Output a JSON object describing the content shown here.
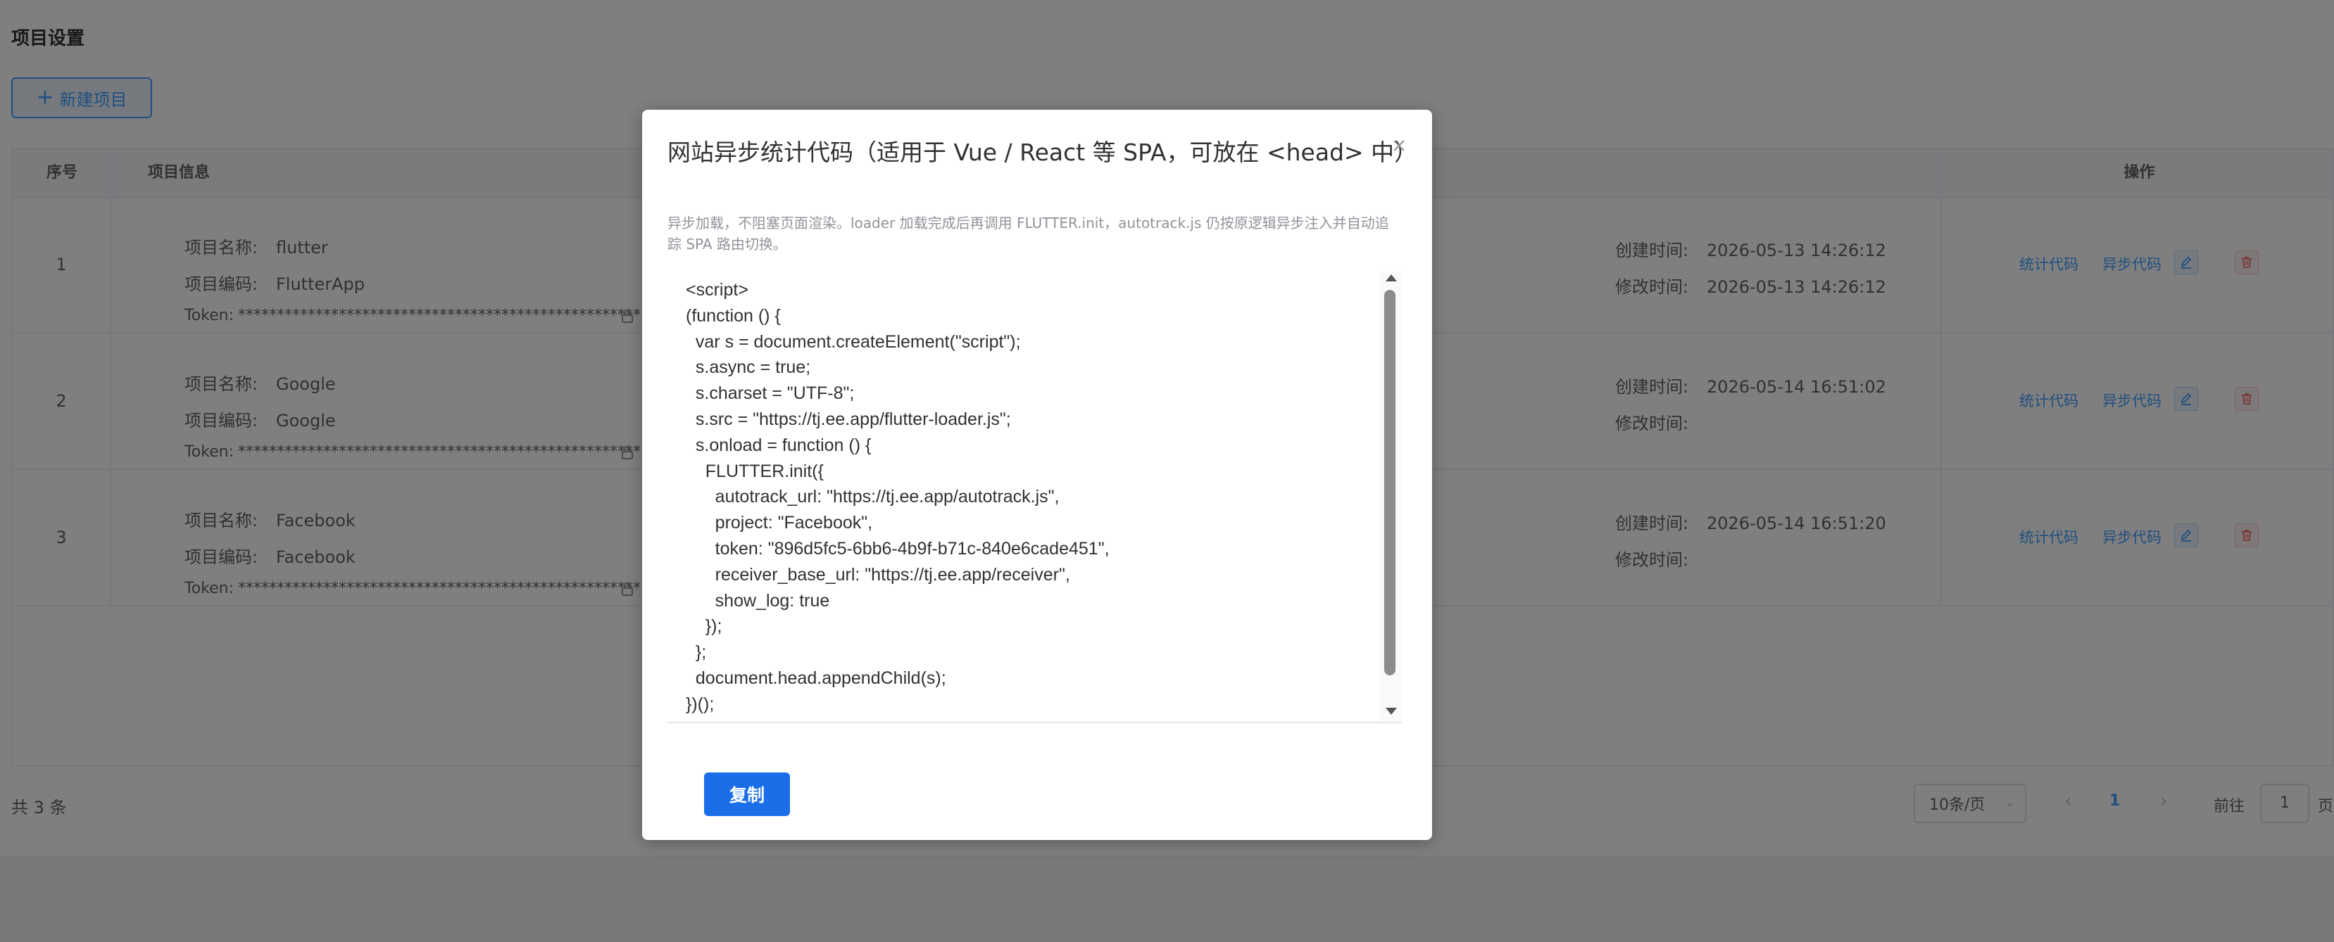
{
  "page": {
    "title": "项目设置",
    "new_button_label": "新建项目"
  },
  "table": {
    "headers": {
      "index": "序号",
      "info": "项目信息",
      "operations": "操作"
    },
    "labels": {
      "name": "项目名称:",
      "code": "项目编码:",
      "token": "Token:",
      "created": "创建时间:",
      "modified": "修改时间:"
    },
    "rows": [
      {
        "index": "1",
        "name": "flutter",
        "code": "FlutterApp",
        "token": "****************************************************",
        "created": "2026-05-13 14:26:12",
        "modified": "2026-05-13 14:26:12"
      },
      {
        "index": "2",
        "name": "Google",
        "code": "Google",
        "token": "****************************************************",
        "created": "2026-05-14 16:51:02",
        "modified": ""
      },
      {
        "index": "3",
        "name": "Facebook",
        "code": "Facebook",
        "token": "****************************************************",
        "created": "2026-05-14 16:51:20",
        "modified": ""
      }
    ],
    "actions": {
      "stat_code": "统计代码",
      "async_code": "异步代码"
    }
  },
  "footer": {
    "total": "共 3 条",
    "page_size": "10条/页",
    "current_page": "1",
    "goto_label": "前往",
    "goto_value": "1",
    "goto_suffix": "页"
  },
  "dialog": {
    "title": "网站异步统计代码（适用于 Vue / React 等 SPA，可放在 <head> 中）",
    "description": "异步加载，不阻塞页面渲染。loader 加载完成后再调用 FLUTTER.init，autotrack.js 仍按原逻辑异步注入并自动追踪 SPA 路由切换。",
    "code": "<script>\n(function () {\n  var s = document.createElement(\"script\");\n  s.async = true;\n  s.charset = \"UTF-8\";\n  s.src = \"https://tj.ee.app/flutter-loader.js\";\n  s.onload = function () {\n    FLUTTER.init({\n      autotrack_url: \"https://tj.ee.app/autotrack.js\",\n      project: \"Facebook\",\n      token: \"896d5fc5-6bb6-4b9f-b71c-840e6cade451\",\n      receiver_base_url: \"https://tj.ee.app/receiver\",\n      show_log: true\n    });\n  };\n  document.head.appendChild(s);\n})();",
    "copy_label": "复制"
  },
  "colors": {
    "primary": "#409eff",
    "copy_button": "#1a6fe8",
    "danger": "#f56c6c",
    "overlay": "rgba(0,0,0,0.5)"
  }
}
